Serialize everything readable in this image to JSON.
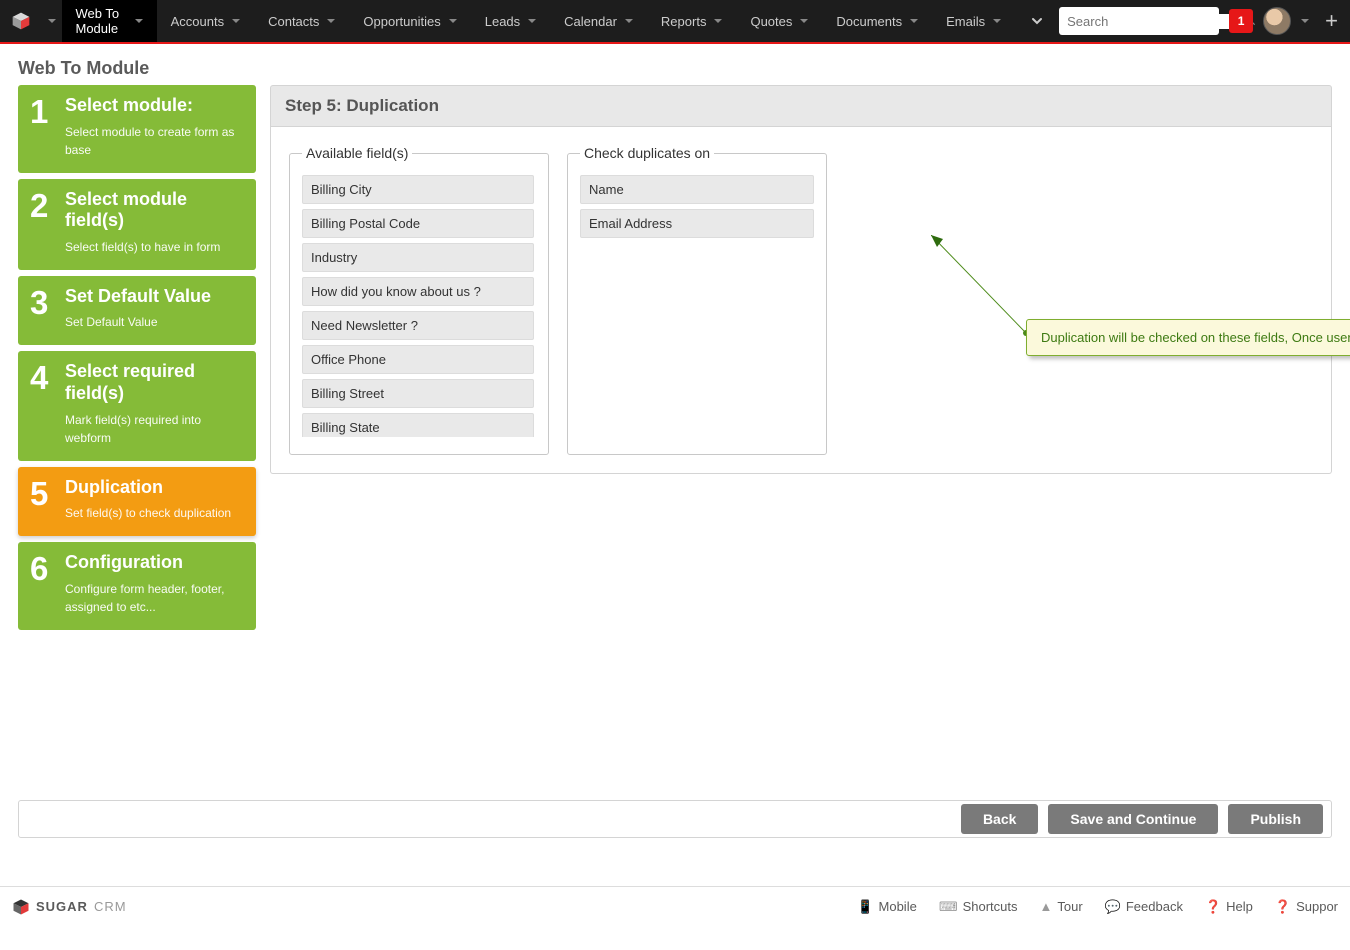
{
  "nav": {
    "items": [
      "Web To Module",
      "Accounts",
      "Contacts",
      "Opportunities",
      "Leads",
      "Calendar",
      "Reports",
      "Quotes",
      "Documents",
      "Emails"
    ],
    "active_index": 0,
    "search_placeholder": "Search",
    "notif_count": "1"
  },
  "page_title": "Web To Module",
  "steps": [
    {
      "num": "1",
      "title": "Select module:",
      "desc": "Select module to create form as base"
    },
    {
      "num": "2",
      "title": "Select module field(s)",
      "desc": "Select field(s) to have in form"
    },
    {
      "num": "3",
      "title": "Set Default Value",
      "desc": "Set Default Value"
    },
    {
      "num": "4",
      "title": "Select required field(s)",
      "desc": "Mark field(s) required into webform"
    },
    {
      "num": "5",
      "title": "Duplication",
      "desc": "Set field(s) to check duplication"
    },
    {
      "num": "6",
      "title": "Configuration",
      "desc": "Configure form header, footer, assigned to etc..."
    }
  ],
  "active_step_index": 4,
  "main": {
    "header": "Step 5: Duplication",
    "available_legend": "Available field(s)",
    "duplicates_legend": "Check duplicates on",
    "available_fields": [
      "Billing City",
      "Billing Postal Code",
      "Industry",
      "How did you know about us ?",
      "Need Newsletter ?",
      "Office Phone",
      "Billing Street",
      "Billing State"
    ],
    "duplicate_fields": [
      "Name",
      "Email Address"
    ],
    "callout_text": "Duplication will be checked on these fields, Once user submit the WebForm."
  },
  "buttons": {
    "back": "Back",
    "save": "Save and Continue",
    "publish": "Publish"
  },
  "footer": {
    "brand_main": "SUGAR",
    "brand_sub": "CRM",
    "links": [
      "Mobile",
      "Shortcuts",
      "Tour",
      "Feedback",
      "Help",
      "Suppor"
    ]
  }
}
